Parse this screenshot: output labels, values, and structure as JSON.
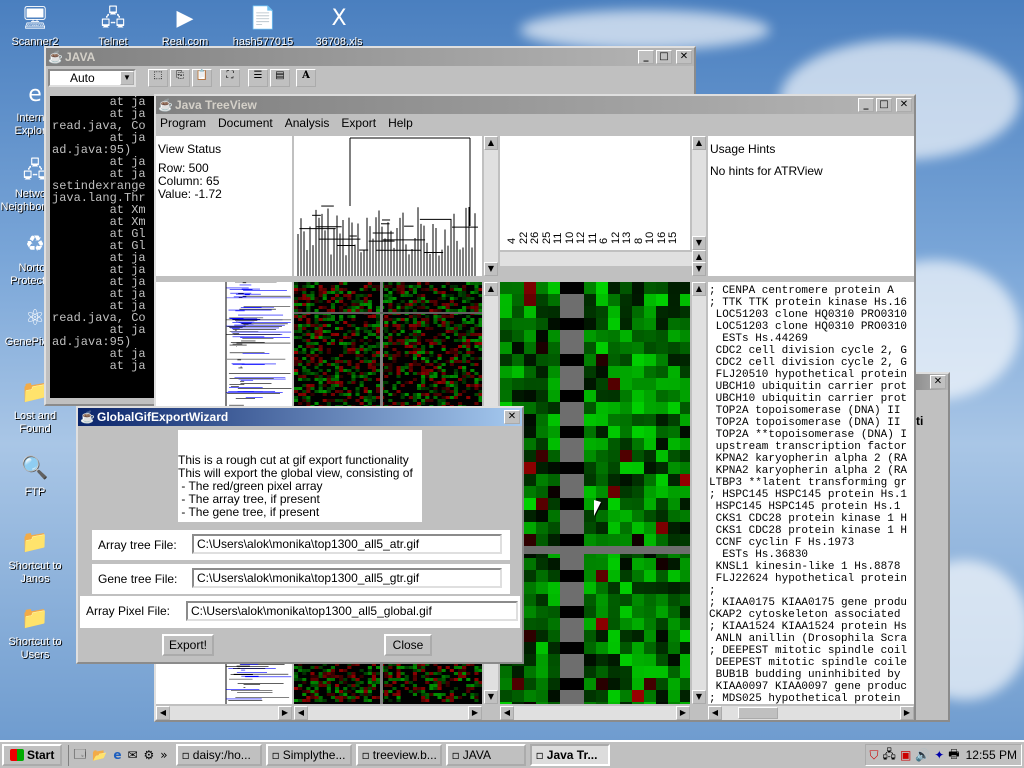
{
  "desktop": {
    "icons": [
      {
        "label": "Scanner2",
        "glyph": "🖥",
        "icon": "computer-icon"
      },
      {
        "label": "Telnet",
        "glyph": "🖧",
        "icon": "telnet-icon"
      },
      {
        "label": "Real.com",
        "glyph": "▶",
        "icon": "real-player-icon"
      },
      {
        "label": "hash577015",
        "glyph": "📄",
        "icon": "document-icon"
      },
      {
        "label": "36708.xls",
        "glyph": "X",
        "icon": "excel-icon"
      },
      {
        "label": "Internet Explorer",
        "glyph": "e",
        "icon": "internet-explorer-icon"
      },
      {
        "label": "Network Neighborhood",
        "glyph": "🖧",
        "icon": "network-icon"
      },
      {
        "label": "Norton Protection",
        "glyph": "♻",
        "icon": "recycle-icon"
      },
      {
        "label": "GenePix 3.0",
        "glyph": "⚛",
        "icon": "genepix-icon"
      },
      {
        "label": "Lost and Found",
        "glyph": "📁",
        "icon": "folder-icon"
      },
      {
        "label": "FTP",
        "glyph": "🔍",
        "icon": "ftp-icon"
      },
      {
        "label": "Shortcut to Janos",
        "glyph": "📁",
        "icon": "folder-shortcut-icon"
      },
      {
        "label": "Shortcut to Users",
        "glyph": "📁",
        "icon": "folder-shortcut-icon"
      }
    ]
  },
  "java_window": {
    "title": "JAVA",
    "font_select": "Auto",
    "console": [
      "        at ja",
      "        at ja",
      "read.java, Co",
      "        at ja",
      "ad.java:95)",
      "        at ja",
      "        at ja",
      "setindexrange",
      "java.lang.Thr",
      "        at Xm",
      "        at Xm",
      "        at Gl",
      "        at Gl",
      "        at ja",
      "        at ja",
      "        at ja",
      "        at ja",
      "        at ja",
      "read.java, Co",
      "        at ja",
      "ad.java:95)",
      "        at ja",
      "        at ja"
    ]
  },
  "treeview": {
    "title": "Java TreeView",
    "menu": [
      "Program",
      "Document",
      "Analysis",
      "Export",
      "Help"
    ],
    "view_status": {
      "heading": "View Status",
      "row": "Row:    500",
      "column": "Column: 65",
      "value": "Value:  -1.72"
    },
    "array_labels": [
      "4",
      "22",
      "26",
      "25",
      "11",
      "10",
      "12",
      "11",
      "6",
      "12",
      "13",
      "8",
      "10",
      "16",
      "15"
    ],
    "usage_hints": {
      "heading": "Usage Hints",
      "text": "No hints for ATRView"
    },
    "gene_names": [
      "; CENPA centromere protein A",
      "; TTK TTK protein kinase Hs.16",
      " LOC51203 clone HQ0310 PRO0310",
      " LOC51203 clone HQ0310 PRO0310",
      "  ESTs Hs.44269",
      " CDC2 cell division cycle 2, G",
      " CDC2 cell division cycle 2, G",
      " FLJ20510 hypothetical protein",
      " UBCH10 ubiquitin carrier prot",
      " UBCH10 ubiquitin carrier prot",
      " TOP2A topoisomerase (DNA) II",
      " TOP2A topoisomerase (DNA) II",
      " TOP2A **topoisomerase (DNA) I",
      " upstream transcription factor",
      " KPNA2 karyopherin alpha 2 (RA",
      " KPNA2 karyopherin alpha 2 (RA",
      "LTBP3 **latent transforming gr",
      "; HSPC145 HSPC145 protein Hs.1",
      " HSPC145 HSPC145 protein Hs.1",
      " CKS1 CDC28 protein kinase 1 H",
      " CKS1 CDC28 protein kinase 1 H",
      " CCNF cyclin F Hs.1973",
      "  ESTs Hs.36830",
      " KNSL1 kinesin-like 1 Hs.8878",
      " FLJ22624 hypothetical protein",
      ";",
      "; KIAA0175 KIAA0175 gene produ",
      "CKAP2 cytoskeleton associated",
      "; KIAA1524 KIAA1524 protein Hs",
      " ANLN anillin (Drosophila Scra",
      "; DEEPEST mitotic spindle coil",
      " DEEPEST mitotic spindle coile",
      " BUB1B budding uninhibited by",
      " KIAA0097 KIAA0097 gene produc",
      "; MDS025 hypothetical protein"
    ]
  },
  "wizard": {
    "title": "GlobalGifExportWizard",
    "description": [
      "This is a rough cut at gif export functionality",
      "This will export the global view, consisting of",
      " - The red/green pixel array",
      " - The array tree, if present",
      " - The gene tree, if present"
    ],
    "array_tree": {
      "label": "Array tree File:",
      "value": "C:\\Users\\alok\\monika\\top1300_all5_atr.gif"
    },
    "gene_tree": {
      "label": "Gene tree File:",
      "value": "C:\\Users\\alok\\monika\\top1300_all5_gtr.gif"
    },
    "array_pixel": {
      "label": "Array Pixel File:",
      "value": "C:\\Users\\alok\\monika\\top1300_all5_global.gif"
    },
    "export_label": "Export!",
    "close_label": "Close"
  },
  "back_window": {
    "fragment": "ti"
  },
  "taskbar": {
    "start_label": "Start",
    "tasks": [
      {
        "label": "daisy:/ho...",
        "pressed": false
      },
      {
        "label": "Simplythe...",
        "pressed": false
      },
      {
        "label": "treeview.b...",
        "pressed": false
      },
      {
        "label": "JAVA",
        "pressed": false
      },
      {
        "label": "Java Tr...",
        "pressed": true
      }
    ],
    "clock": "12:55 PM",
    "chevron": "»"
  },
  "colors": {
    "title_active": "#0a246a",
    "title_inactive": "#808080",
    "heatmap_green": "#00c000",
    "heatmap_red": "#c00000",
    "tree_blue": "#0000ff"
  }
}
